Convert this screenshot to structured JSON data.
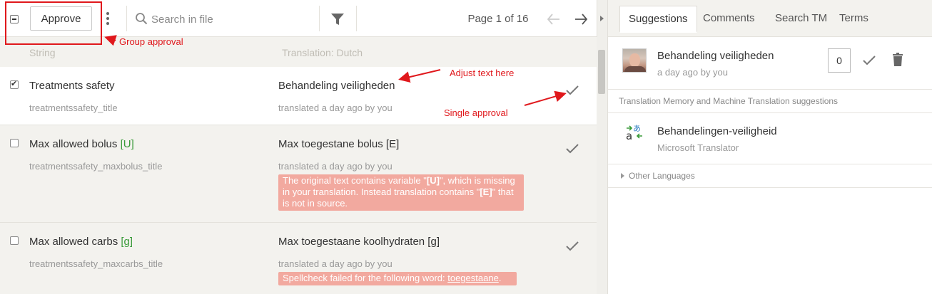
{
  "toolbar": {
    "approve_label": "Approve",
    "search_placeholder": "Search in file",
    "page_info": "Page 1 of 16"
  },
  "columns": {
    "string": "String",
    "translation": "Translation: Dutch"
  },
  "rows": [
    {
      "checked": true,
      "source": "Treatments safety",
      "source_var": "",
      "key": "treatmentssafety_title",
      "translation": "Behandeling veiligheden",
      "meta": "translated a day ago by you"
    },
    {
      "checked": false,
      "source": "Max allowed bolus ",
      "source_var": "[U]",
      "key": "treatmentssafety_maxbolus_title",
      "translation": "Max toegestane bolus [E]",
      "meta": "translated a day ago by you",
      "warning": {
        "p1": "The original text contains variable \"",
        "b1": "[U]",
        "p2": "\", which is missing in your translation. Instead translation contains \"",
        "b2": "[E]",
        "p3": "\" that is not in source."
      }
    },
    {
      "checked": false,
      "source": "Max allowed carbs ",
      "source_var": "[g]",
      "key": "treatmentssafety_maxcarbs_title",
      "translation": "Max toegestaane koolhydraten [g]",
      "meta": "translated a day ago by you",
      "warning": {
        "p1": "Spellcheck failed for the following word: ",
        "u1": "toegestaane",
        "p2": "."
      }
    }
  ],
  "annotations": {
    "group_approval": "Group approval",
    "adjust_text": "Adjust text here",
    "single_approval": "Single approval",
    "color": "#e0181c"
  },
  "tabs": [
    "Suggestions",
    "Comments",
    "Search TM",
    "Terms"
  ],
  "suggestion": {
    "text": "Behandeling veiligheden",
    "meta": "a day ago by you",
    "count": "0"
  },
  "tm_section_label": "Translation Memory and Machine Translation suggestions",
  "mt_suggestion": {
    "text": "Behandelingen-veiligheid",
    "engine": "Microsoft Translator"
  },
  "other_languages": "Other Languages",
  "icons": [
    "search-icon",
    "filter-icon",
    "arrow-left-icon",
    "arrow-right-icon",
    "check-icon",
    "trash-icon",
    "translator-icon",
    "kebab-menu-icon"
  ]
}
